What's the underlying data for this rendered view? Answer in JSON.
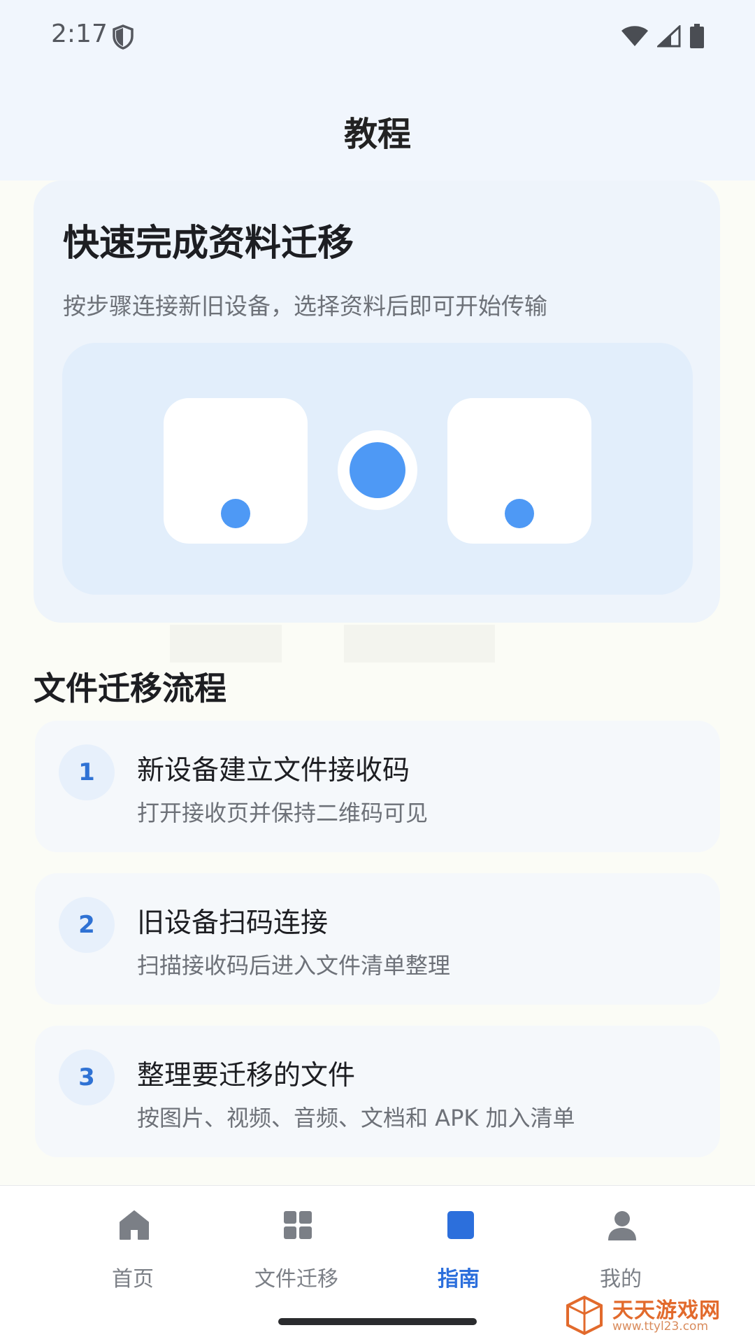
{
  "status_bar": {
    "time": "2:17"
  },
  "header": {
    "title": "教程"
  },
  "hero": {
    "title": "快速完成资料迁移",
    "subtitle": "按步骤连接新旧设备，选择资料后即可开始传输"
  },
  "section": {
    "title": "文件迁移流程"
  },
  "steps": [
    {
      "number": "1",
      "title": "新设备建立文件接收码",
      "desc": "打开接收页并保持二维码可见"
    },
    {
      "number": "2",
      "title": "旧设备扫码连接",
      "desc": "扫描接收码后进入文件清单整理"
    },
    {
      "number": "3",
      "title": "整理要迁移的文件",
      "desc": "按图片、视频、音频、文档和 APK 加入清单"
    }
  ],
  "nav": {
    "items": [
      {
        "label": "首页",
        "icon": "home-icon"
      },
      {
        "label": "文件迁移",
        "icon": "grid-icon"
      },
      {
        "label": "指南",
        "icon": "guide-icon",
        "active": true
      },
      {
        "label": "我的",
        "icon": "person-icon"
      }
    ]
  },
  "colors": {
    "accent": "#2c6fdc",
    "illustration_blue": "#4e99f5",
    "inactive": "#7b7f86"
  },
  "watermark": {
    "line1": "天天游戏网",
    "line2": "www.ttyl23.com"
  }
}
